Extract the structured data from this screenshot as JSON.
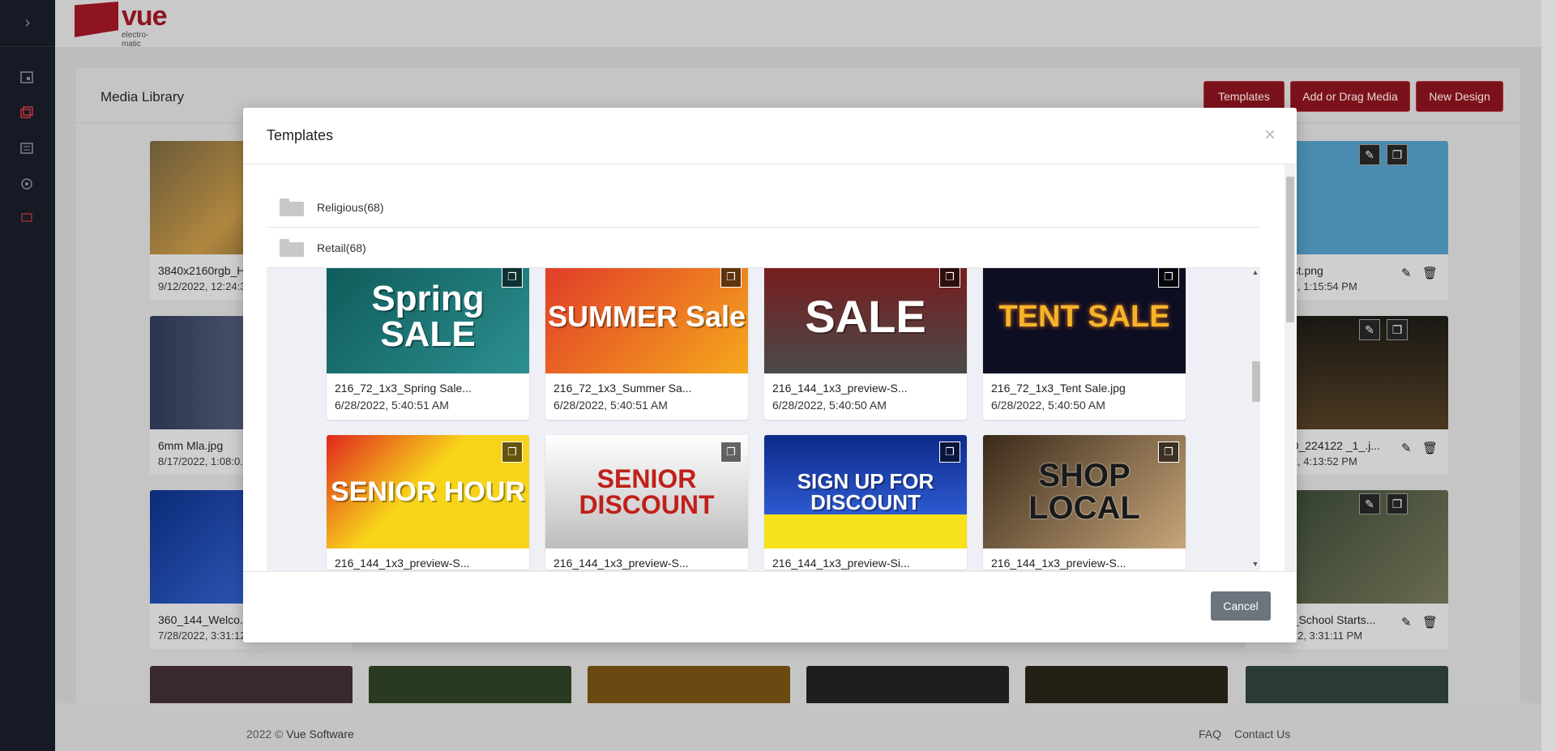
{
  "header": {
    "brand": "vue",
    "brand_sub": "electro-matic"
  },
  "media_library": {
    "title": "Media Library",
    "buttons": {
      "templates": "Templates",
      "add_media": "Add or Drag Media",
      "new_design": "New Design"
    },
    "tiles": [
      {
        "name": "3840x2160rgb_H...",
        "date": "9/12/2022, 12:24:3..."
      },
      {
        "name": "...st.png",
        "date": "...2, 1:15:54 PM"
      },
      {
        "name": "6mm Mla.jpg",
        "date": "8/17/2022, 1:08:0..."
      },
      {
        "name": "...0_224122 _1_.j...",
        "date": "...2, 4:13:52 PM"
      },
      {
        "name": "360_144_Welco...",
        "date": "7/28/2022, 3:31:12..."
      },
      {
        "name": "..._School Starts...",
        "date": "...22, 3:31:11 PM"
      }
    ]
  },
  "modal": {
    "title": "Templates",
    "close_icon": "×",
    "folders": [
      {
        "label": "Religious(68)"
      },
      {
        "label": "Retail(68)"
      }
    ],
    "templates": [
      {
        "name": "216_72_1x3_Spring Sale...",
        "date": "6/28/2022, 5:40:51 AM",
        "art": "Spring SALE",
        "bg": "#1d6a6a"
      },
      {
        "name": "216_72_1x3_Summer Sa...",
        "date": "6/28/2022, 5:40:51 AM",
        "art": "SUMMER Sale",
        "bg": "#e8452c"
      },
      {
        "name": "216_144_1x3_preview-S...",
        "date": "6/28/2022, 5:40:50 AM",
        "art": "SALE",
        "bg": "#5a5a5a"
      },
      {
        "name": "216_72_1x3_Tent Sale.jpg",
        "date": "6/28/2022, 5:40:50 AM",
        "art": "TENT SALE",
        "bg": "#0f1024"
      },
      {
        "name": "216_144_1x3_preview-S...",
        "art": "SENIOR HOUR",
        "bg": "#f7d31a"
      },
      {
        "name": "216_144_1x3_preview-S...",
        "art": "SENIOR DISCOUNT",
        "bg": "#d9d9d9"
      },
      {
        "name": "216_144_1x3_preview-Si...",
        "art": "SIGN UP FOR DISCOUNT",
        "bg": "#1a3d9c"
      },
      {
        "name": "216_144_1x3_preview-S...",
        "art": "SHOP LOCAL",
        "bg": "#a98a65"
      }
    ],
    "cancel": "Cancel"
  },
  "footer": {
    "copyright": "2022 ©",
    "company": "Vue Software",
    "faq": "FAQ",
    "contact": "Contact Us"
  }
}
